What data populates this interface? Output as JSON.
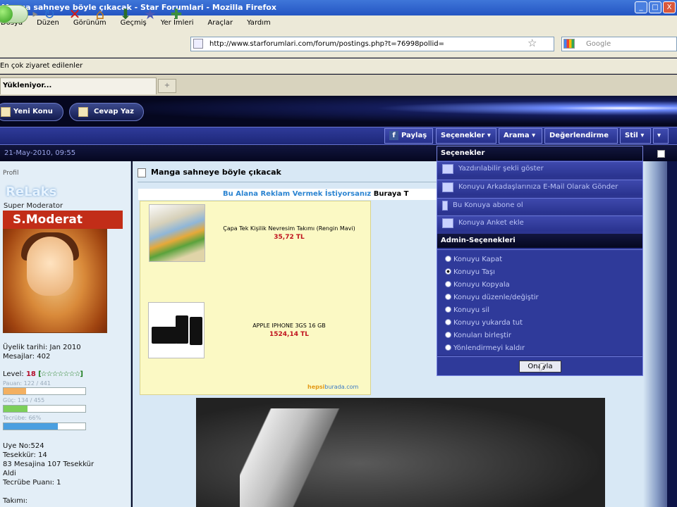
{
  "window": {
    "title": "Manga sahneye böyle çıkacak - Star Forumlari - Mozilla Firefox",
    "controls": [
      "_",
      "□",
      "X"
    ]
  },
  "menubar": [
    "Dosya",
    "Düzen",
    "Görünüm",
    "Geçmiş",
    "Yer İmleri",
    "Araçlar",
    "Yardım"
  ],
  "nav": {
    "url": "http://www.starforumlari.com/forum/postings.php?t=76998pollid=",
    "search_placeholder": "Google"
  },
  "bookmarks_label": "En çok ziyaret edilenler",
  "tab": {
    "label": "Yükleniyor...",
    "new_tab": "+"
  },
  "forum": {
    "new_topic": "Yeni Konu",
    "reply": "Cevap Yaz",
    "toolbar": {
      "share": "Paylaş",
      "options": "Seçenekler",
      "search": "Arama",
      "rate": "Değerlendirme",
      "style": "Stil",
      "more": "▾"
    },
    "date": "21-May-2010, 09:55"
  },
  "profile": {
    "section_label": "Profil",
    "username": "ReLaks",
    "title": "Super Moderator",
    "avatar_text": "S.Moderat",
    "join_date": "Üyelik tarihi: Jan 2010",
    "posts": "Mesajlar: 402",
    "level_label": "Level:",
    "level_value": "18",
    "level_stars": "[☆☆☆☆☆☆☆]",
    "bar1_label": "Pauan: 122 / 441",
    "bar1_fill": 0.28,
    "bar2_label": "Güç: 134 / 455",
    "bar2_fill": 0.29,
    "bar3_label": "Tecrübe: 66%",
    "bar3_fill": 0.66,
    "member_no": "Uye No:524",
    "thanks": "Tesekkür: 14",
    "thanked": "83 Mesajina 107 Tesekkür Aldi",
    "exp_points": "Tecrübe Puanı: 1",
    "team": "Takımı:"
  },
  "post": {
    "title": "Manga sahneye böyle çıkacak",
    "ad_marquee_1": "Bu Alana Reklam Vermek İstiyorsanız",
    "ad_marquee_2": "Buraya T",
    "ads": [
      {
        "name": "Çapa Tek Kişilik Nevresim Takımı (Rengin Mavi)",
        "price": "35,72 TL"
      },
      {
        "name": "APPLE IPHONE 3GS 16 GB",
        "price": "1524,14 TL"
      }
    ],
    "ad_logo_1": "hepsi",
    "ad_logo_2": "burada.com"
  },
  "dropdown": {
    "header1": "Seçenekler",
    "items": [
      "Yazdırılabilir şekli göster",
      "Konuyu Arkadaşlarınıza E-Mail Olarak Gönder",
      "Bu Konuya abone ol",
      "Konuya Anket ekle"
    ],
    "header2": "Admin-Seçenekleri",
    "radios": [
      "Konuyu Kapat",
      "Konuyu Taşı",
      "Konuyu Kopyala",
      "Konuyu düzenle/değiştir",
      "Konuyu sil",
      "Konuyu yukarda tut",
      "Konuları birleştir",
      "Yönlendirmeyi kaldır"
    ],
    "apply": "Onayla"
  }
}
